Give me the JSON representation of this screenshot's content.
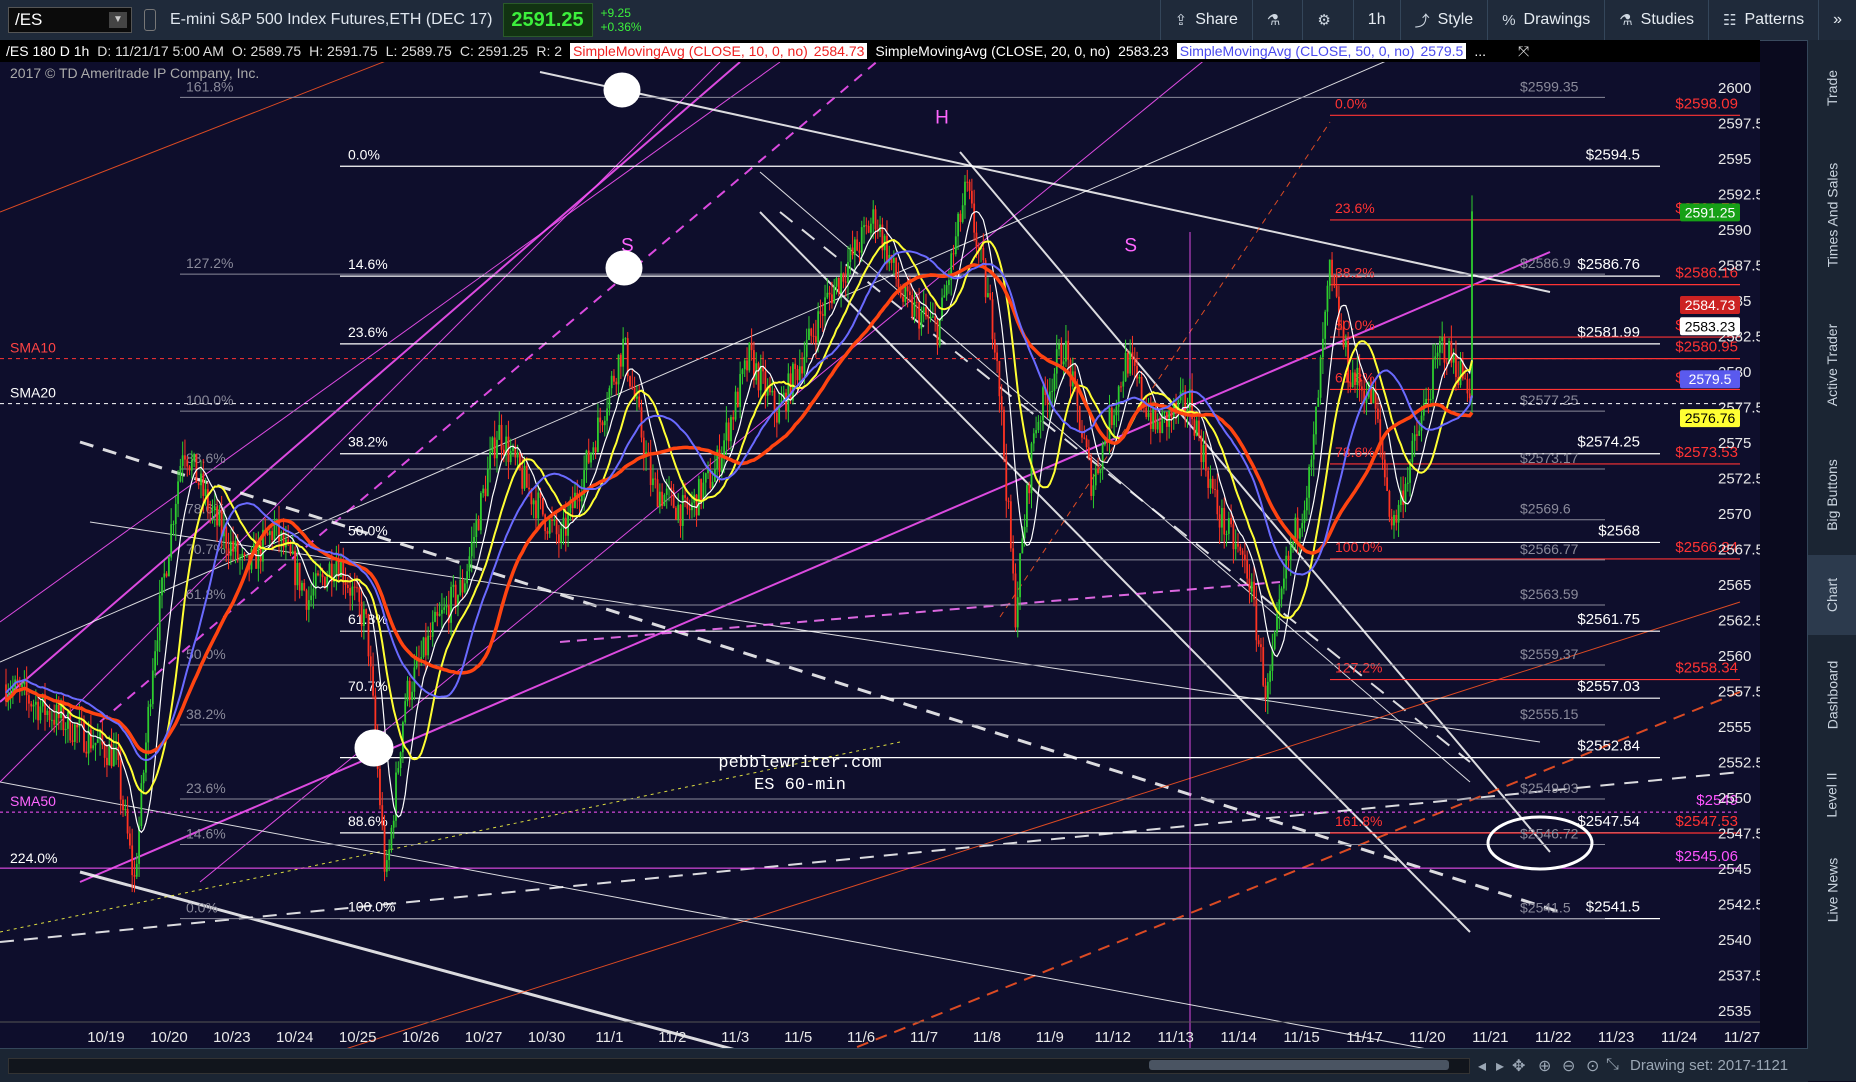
{
  "header": {
    "symbol": "/ES",
    "title": "E-mini S&P 500 Index Futures,ETH (DEC 17)",
    "last": "2591.25",
    "net_change": "+9.25",
    "pct_change": "+0.36%",
    "buttons": [
      {
        "label": "Share",
        "icon": "share-icon"
      },
      {
        "label": "",
        "icon": "flask-icon"
      },
      {
        "label": "",
        "icon": "gear-icon"
      },
      {
        "label": "1h",
        "icon": ""
      },
      {
        "label": "Style",
        "icon": "style-icon"
      },
      {
        "label": "Drawings",
        "icon": "drawings-icon"
      },
      {
        "label": "Studies",
        "icon": "studies-icon"
      },
      {
        "label": "Patterns",
        "icon": "patterns-icon"
      }
    ]
  },
  "infobar": {
    "period": "/ES 180 D 1h",
    "datetime": "D: 11/21/17 5:00 AM",
    "open": "O: 2589.75",
    "high": "H: 2591.75",
    "low": "L: 2589.75",
    "close": "C: 2591.25",
    "r": "R: 2",
    "sma10": "SimpleMovingAvg (CLOSE, 10, 0, no)",
    "sma10_val": "2584.73",
    "sma20": "SimpleMovingAvg (CLOSE, 20, 0, no)",
    "sma20_val": "2583.23",
    "sma50": "SimpleMovingAvg (CLOSE, 50, 0, no)",
    "sma50_val": "2579.5",
    "more": "..."
  },
  "sidebar": {
    "tabs": [
      "Trade",
      "Times And Sales",
      "Active Trader",
      "Big Buttons",
      "Chart",
      "Dashboard",
      "Level II",
      "Live News"
    ],
    "active": "Chart"
  },
  "bottombar": {
    "drawing_set": "Drawing set: 2017-1121"
  },
  "chart_data": {
    "type": "candlestick",
    "copyright": "2017 © TD Ameritrade IP Company, Inc.",
    "watermark": [
      "pebblewriter.com",
      "ES 60-min"
    ],
    "x_ticks": [
      "10/19",
      "10/20",
      "10/23",
      "10/24",
      "10/25",
      "10/26",
      "10/27",
      "10/30",
      "11/1",
      "11/2",
      "11/3",
      "11/5",
      "11/6",
      "11/7",
      "11/8",
      "11/9",
      "11/12",
      "11/13",
      "11/14",
      "11/15",
      "11/17",
      "11/20",
      "11/21",
      "11/22",
      "11/23",
      "11/24",
      "11/27"
    ],
    "y_ticks": [
      2600,
      2597.5,
      2595,
      2592.5,
      2590,
      2587.5,
      2585,
      2582.5,
      2580,
      2577.5,
      2575,
      2572.5,
      2570,
      2567.5,
      2565,
      2562.5,
      2560,
      2557.5,
      2555,
      2552.5,
      2550,
      2547.5,
      2545,
      2542.5,
      2540,
      2537.5,
      2535
    ],
    "ylim": [
      2534.5,
      2601
    ],
    "price_path": [
      {
        "x": "10/18",
        "y": 2558
      },
      {
        "x": "10/19",
        "y": 2553
      },
      {
        "x": "10/19",
        "y": 2544
      },
      {
        "x": "10/19",
        "y": 2560
      },
      {
        "x": "10/20",
        "y": 2575
      },
      {
        "x": "10/20",
        "y": 2570
      },
      {
        "x": "10/23",
        "y": 2566
      },
      {
        "x": "10/23",
        "y": 2569
      },
      {
        "x": "10/24",
        "y": 2564
      },
      {
        "x": "10/24",
        "y": 2567
      },
      {
        "x": "10/25",
        "y": 2562
      },
      {
        "x": "10/25",
        "y": 2544
      },
      {
        "x": "10/25",
        "y": 2557
      },
      {
        "x": "10/26",
        "y": 2562
      },
      {
        "x": "10/26",
        "y": 2565
      },
      {
        "x": "10/27",
        "y": 2576
      },
      {
        "x": "10/27",
        "y": 2572
      },
      {
        "x": "10/30",
        "y": 2568
      },
      {
        "x": "10/30",
        "y": 2574
      },
      {
        "x": "11/1",
        "y": 2582
      },
      {
        "x": "11/1",
        "y": 2572
      },
      {
        "x": "11/2",
        "y": 2570
      },
      {
        "x": "11/2",
        "y": 2573
      },
      {
        "x": "11/3",
        "y": 2581
      },
      {
        "x": "11/3",
        "y": 2577
      },
      {
        "x": "11/5",
        "y": 2585
      },
      {
        "x": "11/6",
        "y": 2591
      },
      {
        "x": "11/6",
        "y": 2585
      },
      {
        "x": "11/7",
        "y": 2583
      },
      {
        "x": "11/7",
        "y": 2593
      },
      {
        "x": "11/8",
        "y": 2582
      },
      {
        "x": "11/8",
        "y": 2563
      },
      {
        "x": "11/8",
        "y": 2576
      },
      {
        "x": "11/9",
        "y": 2582
      },
      {
        "x": "11/9",
        "y": 2572
      },
      {
        "x": "11/12",
        "y": 2581
      },
      {
        "x": "11/12",
        "y": 2576
      },
      {
        "x": "11/13",
        "y": 2578
      },
      {
        "x": "11/13",
        "y": 2570
      },
      {
        "x": "11/14",
        "y": 2566
      },
      {
        "x": "11/14",
        "y": 2557
      },
      {
        "x": "11/14",
        "y": 2566
      },
      {
        "x": "11/15",
        "y": 2573
      },
      {
        "x": "11/15",
        "y": 2587
      },
      {
        "x": "11/15",
        "y": 2580
      },
      {
        "x": "11/17",
        "y": 2578
      },
      {
        "x": "11/17",
        "y": 2569
      },
      {
        "x": "11/17",
        "y": 2574
      },
      {
        "x": "11/20",
        "y": 2582
      },
      {
        "x": "11/20",
        "y": 2579
      },
      {
        "x": "11/21",
        "y": 2584
      },
      {
        "x": "11/21",
        "y": 2591.25
      }
    ],
    "series": [
      {
        "name": "SMA10",
        "color": "#ffffff"
      },
      {
        "name": "SMA20",
        "color": "#ffff33"
      },
      {
        "name": "SMA50",
        "color": "#ff4411"
      }
    ],
    "left_labels": [
      {
        "text": "SMA10",
        "y": 2580.95,
        "color": "#ff4444"
      },
      {
        "text": "SMA20",
        "y": 2577.78,
        "color": "#ffffff"
      },
      {
        "text": "SMA50",
        "y": 2549,
        "color": "#ff66ff"
      },
      {
        "text": "224.0%",
        "y": 2545,
        "color": "#ffffff"
      }
    ],
    "annotations": [
      {
        "text": "H",
        "x": "11/7",
        "y": 2597.5,
        "color": "#ff66ff"
      },
      {
        "text": "S",
        "x": "11/1",
        "y": 2588.5,
        "color": "#ff66ff"
      },
      {
        "text": "S",
        "x": "11/12",
        "y": 2588.5,
        "color": "#ff66ff"
      }
    ],
    "white_fib": [
      {
        "pct": "0.0%",
        "price": "$2594.5",
        "y": 2594.5
      },
      {
        "pct": "14.6%",
        "price": "$2586.76",
        "y": 2586.76
      },
      {
        "pct": "23.6%",
        "price": "$2581.99",
        "y": 2581.99
      },
      {
        "pct": "38.2%",
        "price": "$2574.25",
        "y": 2574.25
      },
      {
        "pct": "50.0%",
        "price": "$2568",
        "y": 2568
      },
      {
        "pct": "61.8%",
        "price": "$2561.75",
        "y": 2561.75
      },
      {
        "pct": "70.7%",
        "price": "$2557.03",
        "y": 2557.03
      },
      {
        "pct": "",
        "price": "$2552.84",
        "y": 2552.84
      },
      {
        "pct": "88.6%",
        "price": "$2547.54",
        "y": 2547.54
      },
      {
        "pct": "100.0%",
        "price": "$2541.5",
        "y": 2541.5
      }
    ],
    "red_fib": [
      {
        "pct": "0.0%",
        "price": "$2598.09",
        "y": 2598.09
      },
      {
        "pct": "23.6%",
        "price": "$2590.72",
        "y": 2590.72
      },
      {
        "pct": "38.2%",
        "price": "$2586.16",
        "y": 2586.16
      },
      {
        "pct": "50.0%",
        "price": "$2582.47",
        "y": 2582.47
      },
      {
        "pct": "",
        "price": "$2580.95",
        "y": 2580.95
      },
      {
        "pct": "61.8%",
        "price": "$2578.78",
        "y": 2578.78
      },
      {
        "pct": "78.6%",
        "price": "$2573.53",
        "y": 2573.53
      },
      {
        "pct": "100.0%",
        "price": "$2566.84",
        "y": 2566.84
      },
      {
        "pct": "127.2%",
        "price": "$2558.34",
        "y": 2558.34
      },
      {
        "pct": "161.8%",
        "price": "$2547.53",
        "y": 2547.53
      }
    ],
    "magenta_levels": [
      {
        "price": "$2549",
        "y": 2549
      },
      {
        "price": "$2545.06",
        "y": 2545.06
      }
    ],
    "grey_fib": [
      {
        "pct": "161.8%",
        "price": "$2599.35",
        "y": 2599.35
      },
      {
        "pct": "127.2%",
        "price": "$2586.9",
        "y": 2586.9
      },
      {
        "pct": "100.0%",
        "price": "$2577.25",
        "y": 2577.25
      },
      {
        "pct": "88.6%",
        "price": "$2573.17",
        "y": 2573.17
      },
      {
        "pct": "78.6%",
        "price": "$2569.6",
        "y": 2569.6
      },
      {
        "pct": "70.7%",
        "price": "$2566.77",
        "y": 2566.77
      },
      {
        "pct": "61.8%",
        "price": "$2563.59",
        "y": 2563.59
      },
      {
        "pct": "50.0%",
        "price": "$2559.37",
        "y": 2559.37
      },
      {
        "pct": "38.2%",
        "price": "$2555.15",
        "y": 2555.15
      },
      {
        "pct": "23.6%",
        "price": "$2549.93",
        "y": 2549.93
      },
      {
        "pct": "14.6%",
        "price": "$2546.72",
        "y": 2546.72
      },
      {
        "pct": "0.0%",
        "price": "$2541.5",
        "y": 2541.5
      }
    ],
    "price_bubbles": [
      {
        "text": "2591.25",
        "y": 2591.25,
        "bg": "#16a016",
        "fg": "#ffffff"
      },
      {
        "text": "2584.73",
        "y": 2584.73,
        "bg": "#cc2222",
        "fg": "#ffffff"
      },
      {
        "text": "2583.23",
        "y": 2583.23,
        "bg": "#ffffff",
        "fg": "#000000"
      },
      {
        "text": "2579.5",
        "y": 2579.5,
        "bg": "#5a5aee",
        "fg": "#ffffff"
      },
      {
        "text": "2576.76",
        "y": 2576.76,
        "bg": "#ffff33",
        "fg": "#000000"
      }
    ]
  }
}
